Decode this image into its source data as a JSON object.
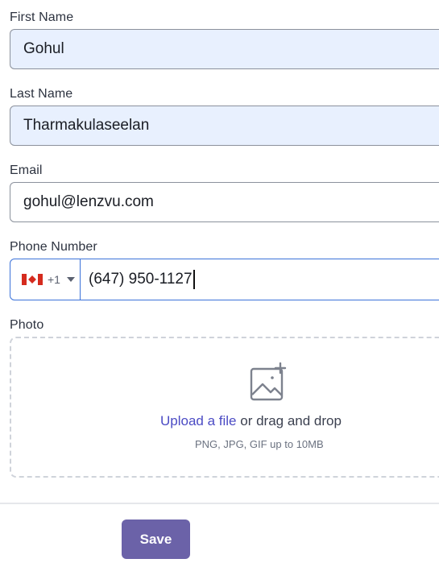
{
  "form": {
    "first_name": {
      "label": "First Name",
      "value": "Gohul"
    },
    "last_name": {
      "label": "Last Name",
      "value": "Tharmakulaseelan"
    },
    "email": {
      "label": "Email",
      "value": "gohul@lenzvu.com"
    },
    "phone": {
      "label": "Phone Number",
      "country_flag": "canada-flag-icon",
      "dial_code": "+1",
      "value": "(647) 950-1127"
    },
    "photo": {
      "label": "Photo",
      "icon": "image-add-icon",
      "upload_link": "Upload a file",
      "upload_rest": " or drag and drop",
      "hint": "PNG, JPG, GIF up to 10MB"
    }
  },
  "actions": {
    "save_label": "Save"
  },
  "colors": {
    "autofill_bg": "#e8f0fe",
    "focus_border": "#3b72d9",
    "link": "#4b4bc4",
    "save_button": "#6b62a8"
  }
}
